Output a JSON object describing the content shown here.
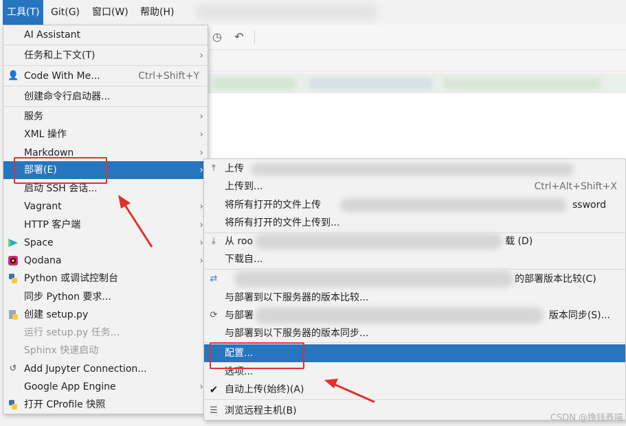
{
  "menubar": {
    "items": [
      {
        "label": "工具(T)",
        "active": true
      },
      {
        "label": "Git(G)"
      },
      {
        "label": "窗口(W)"
      },
      {
        "label": "帮助(H)"
      }
    ]
  },
  "tools_menu": {
    "items": [
      {
        "label": "AI Assistant"
      },
      {
        "label": "任务和上下文(T)",
        "submenu": true
      },
      {
        "label": "Code With Me...",
        "shortcut": "Ctrl+Shift+Y",
        "icon": "user-icon"
      },
      {
        "label": "创建命令行启动器..."
      },
      {
        "label": "服务",
        "submenu": true
      },
      {
        "label": "XML 操作",
        "submenu": true
      },
      {
        "label": "Markdown",
        "submenu": true
      },
      {
        "label": "部署(E)",
        "submenu": true,
        "selected": true
      },
      {
        "label": "启动 SSH 会话..."
      },
      {
        "label": "Vagrant",
        "submenu": true
      },
      {
        "label": "HTTP 客户端",
        "submenu": true
      },
      {
        "label": "Space",
        "submenu": true,
        "icon": "space-icon"
      },
      {
        "label": "Qodana",
        "submenu": true,
        "icon": "qodana-icon"
      },
      {
        "label": "Python 或调试控制台",
        "icon": "python-icon"
      },
      {
        "label": "同步 Python 要求..."
      },
      {
        "label": "创建 setup.py",
        "icon": "setup-icon"
      },
      {
        "label": "运行 setup.py 任务...",
        "disabled": true
      },
      {
        "label": "Sphinx 快速启动",
        "disabled": true
      },
      {
        "label": "Add Jupyter Connection...",
        "icon": "jupyter-icon"
      },
      {
        "label": "Google App Engine",
        "submenu": true
      },
      {
        "label": "打开 CProfile 快照",
        "icon": "python-icon"
      }
    ]
  },
  "deploy_menu": {
    "items": [
      {
        "label": "上传",
        "icon": "upload-icon"
      },
      {
        "label": "上传到...",
        "shortcut": "Ctrl+Alt+Shift+X"
      },
      {
        "label": "将所有打开的文件上传",
        "label_tail": "ssword"
      },
      {
        "label": "将所有打开的文件上传到..."
      },
      {
        "label": "从 roo",
        "label_tail": "载 (D)",
        "icon": "download-icon"
      },
      {
        "label": "下载自..."
      },
      {
        "label": "",
        "label_tail": "的部署版本比较(C)",
        "icon": "compare-icon"
      },
      {
        "label": "与部署到以下服务器的版本比较..."
      },
      {
        "label": "与部署",
        "label_tail": "版本同步(S)...",
        "icon": "sync-icon"
      },
      {
        "label": "与部署到以下服务器的版本同步..."
      },
      {
        "label": "配置...",
        "selected": true
      },
      {
        "label": "选项..."
      },
      {
        "label": "自动上传(始终)(A)",
        "checked": true,
        "icon": "check-icon"
      },
      {
        "label": "浏览远程主机(B)",
        "icon": "remote-host-icon"
      }
    ]
  },
  "watermark": "CSDN @挣钱养喵",
  "colors": {
    "accent": "#2675bf",
    "annotation": "#e0302c"
  }
}
